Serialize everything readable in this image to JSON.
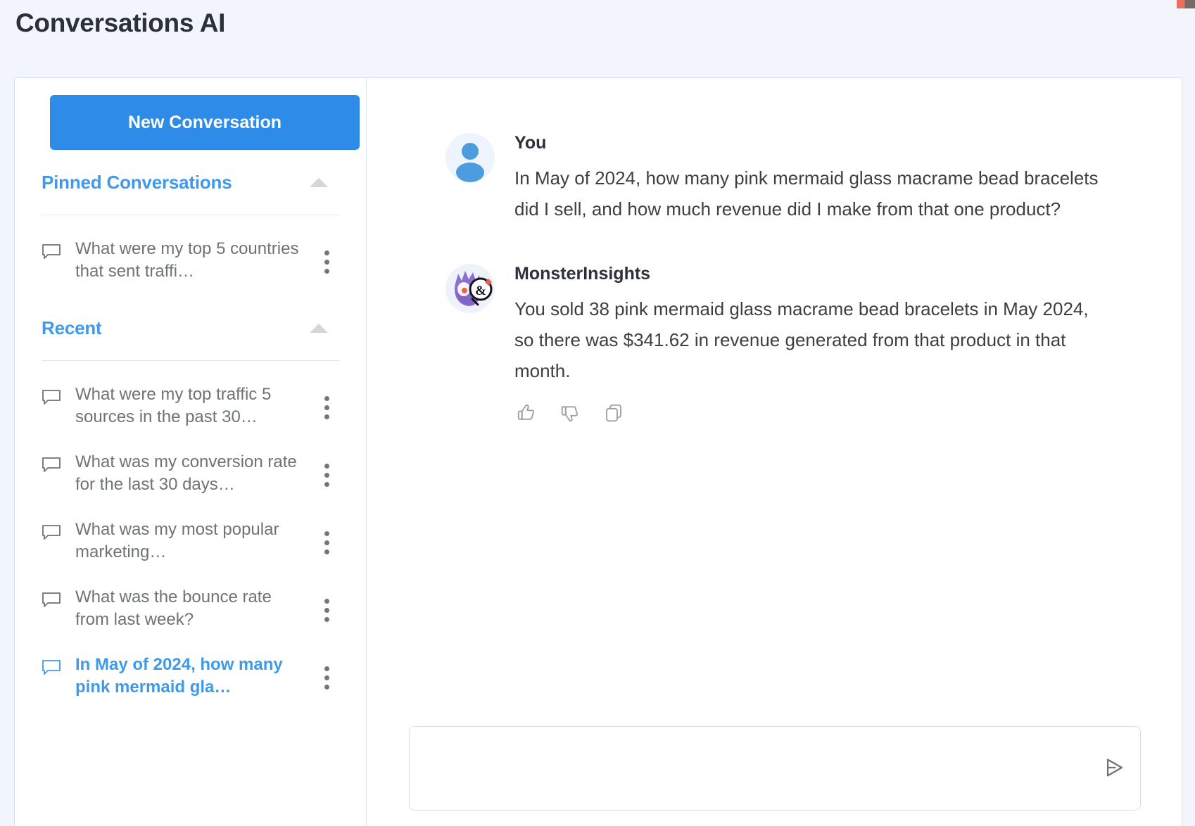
{
  "header": {
    "title": "Conversations AI"
  },
  "sidebar": {
    "new_conversation_label": "New Conversation",
    "sections": [
      {
        "title": "Pinned Conversations",
        "collapse_icon": "caret-up-icon",
        "items": [
          {
            "label": "What were my top 5 countries that sent traffi…",
            "icon": "chat-bubble-icon",
            "active": false
          }
        ]
      },
      {
        "title": "Recent",
        "collapse_icon": "caret-up-icon",
        "items": [
          {
            "label": "What were my top traffic 5 sources in the past 30…",
            "icon": "chat-bubble-icon",
            "active": false
          },
          {
            "label": "What was my conversion rate for the last 30 days…",
            "icon": "chat-bubble-icon",
            "active": false
          },
          {
            "label": "What was my most popular marketing…",
            "icon": "chat-bubble-icon",
            "active": false
          },
          {
            "label": "What was the bounce rate from last week?",
            "icon": "chat-bubble-icon",
            "active": false
          },
          {
            "label": "In May of 2024, how many pink mermaid gla…",
            "icon": "chat-bubble-icon",
            "active": true
          }
        ]
      }
    ],
    "item_menu_icon": "kebab-menu-icon"
  },
  "chat": {
    "messages": [
      {
        "author": "You",
        "avatar": "user-avatar-icon",
        "text": "In May of 2024, how many pink mermaid glass macrame bead bracelets did I sell, and how much revenue did I make from that one product?",
        "actions": []
      },
      {
        "author": "MonsterInsights",
        "avatar": "monsterinsights-avatar-icon",
        "text": "You sold 38 pink mermaid glass macrame bead bracelets in May 2024, so there was $341.62 in revenue generated from that product in that month.",
        "actions": [
          "thumbs-up-icon",
          "thumbs-down-icon",
          "copy-icon"
        ]
      }
    ],
    "composer": {
      "value": "",
      "placeholder": "",
      "send_icon": "send-icon"
    }
  },
  "colors": {
    "accent": "#2e8ce8",
    "link": "#3f9bea",
    "page_bg": "#f2f6fc",
    "card_bg": "#ffffff",
    "border": "#d3e0ee",
    "text_primary": "#2b303b",
    "text_body": "#3c4043",
    "text_muted": "#6e7377"
  }
}
